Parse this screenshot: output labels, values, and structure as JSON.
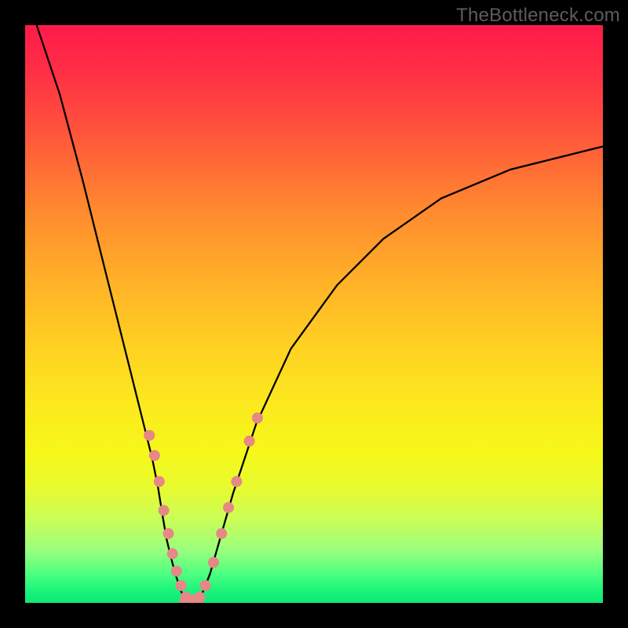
{
  "watermark": "TheBottleneck.com",
  "chart_data": {
    "type": "line",
    "title": "",
    "xlabel": "",
    "ylabel": "",
    "xlim": [
      0,
      100
    ],
    "ylim": [
      0,
      100
    ],
    "curve_left": {
      "description": "steep descending branch from top-left into valley",
      "x": [
        2,
        6,
        10,
        14,
        18,
        20,
        22,
        23,
        23.8,
        24.5,
        25.2,
        26,
        27,
        28
      ],
      "y": [
        100,
        88,
        73,
        57,
        41,
        33,
        25,
        20,
        15,
        11,
        8,
        5,
        2,
        0
      ]
    },
    "curve_right": {
      "description": "ascending branch from valley to right edge",
      "x": [
        30,
        32,
        34,
        36,
        40,
        46,
        54,
        62,
        72,
        84,
        100
      ],
      "y": [
        0,
        5,
        12,
        19,
        31,
        44,
        55,
        63,
        70,
        75,
        79
      ]
    },
    "valley_floor": {
      "x": [
        27.5,
        30
      ],
      "y": [
        0,
        0
      ]
    },
    "dots": {
      "left_branch": [
        {
          "x": 21.5,
          "y": 29
        },
        {
          "x": 22.4,
          "y": 25.5
        },
        {
          "x": 23.2,
          "y": 21
        },
        {
          "x": 24.0,
          "y": 16
        },
        {
          "x": 24.8,
          "y": 12
        },
        {
          "x": 25.5,
          "y": 8.5
        },
        {
          "x": 26.2,
          "y": 5.5
        },
        {
          "x": 27.0,
          "y": 3
        }
      ],
      "floor": [
        {
          "x": 27.8,
          "y": 1.0
        },
        {
          "x": 28.6,
          "y": 0.5
        },
        {
          "x": 29.4,
          "y": 0.5
        },
        {
          "x": 30.2,
          "y": 1.0
        }
      ],
      "right_branch": [
        {
          "x": 31.2,
          "y": 3
        },
        {
          "x": 32.6,
          "y": 7
        },
        {
          "x": 34.0,
          "y": 12
        },
        {
          "x": 35.2,
          "y": 16.5
        },
        {
          "x": 36.6,
          "y": 21
        },
        {
          "x": 38.8,
          "y": 28
        },
        {
          "x": 40.2,
          "y": 32
        }
      ]
    },
    "colors": {
      "curve_stroke": "#000000",
      "dot_fill": "#e58886",
      "gradient_top": "#ff1a4a",
      "gradient_bottom": "#10e874"
    }
  }
}
